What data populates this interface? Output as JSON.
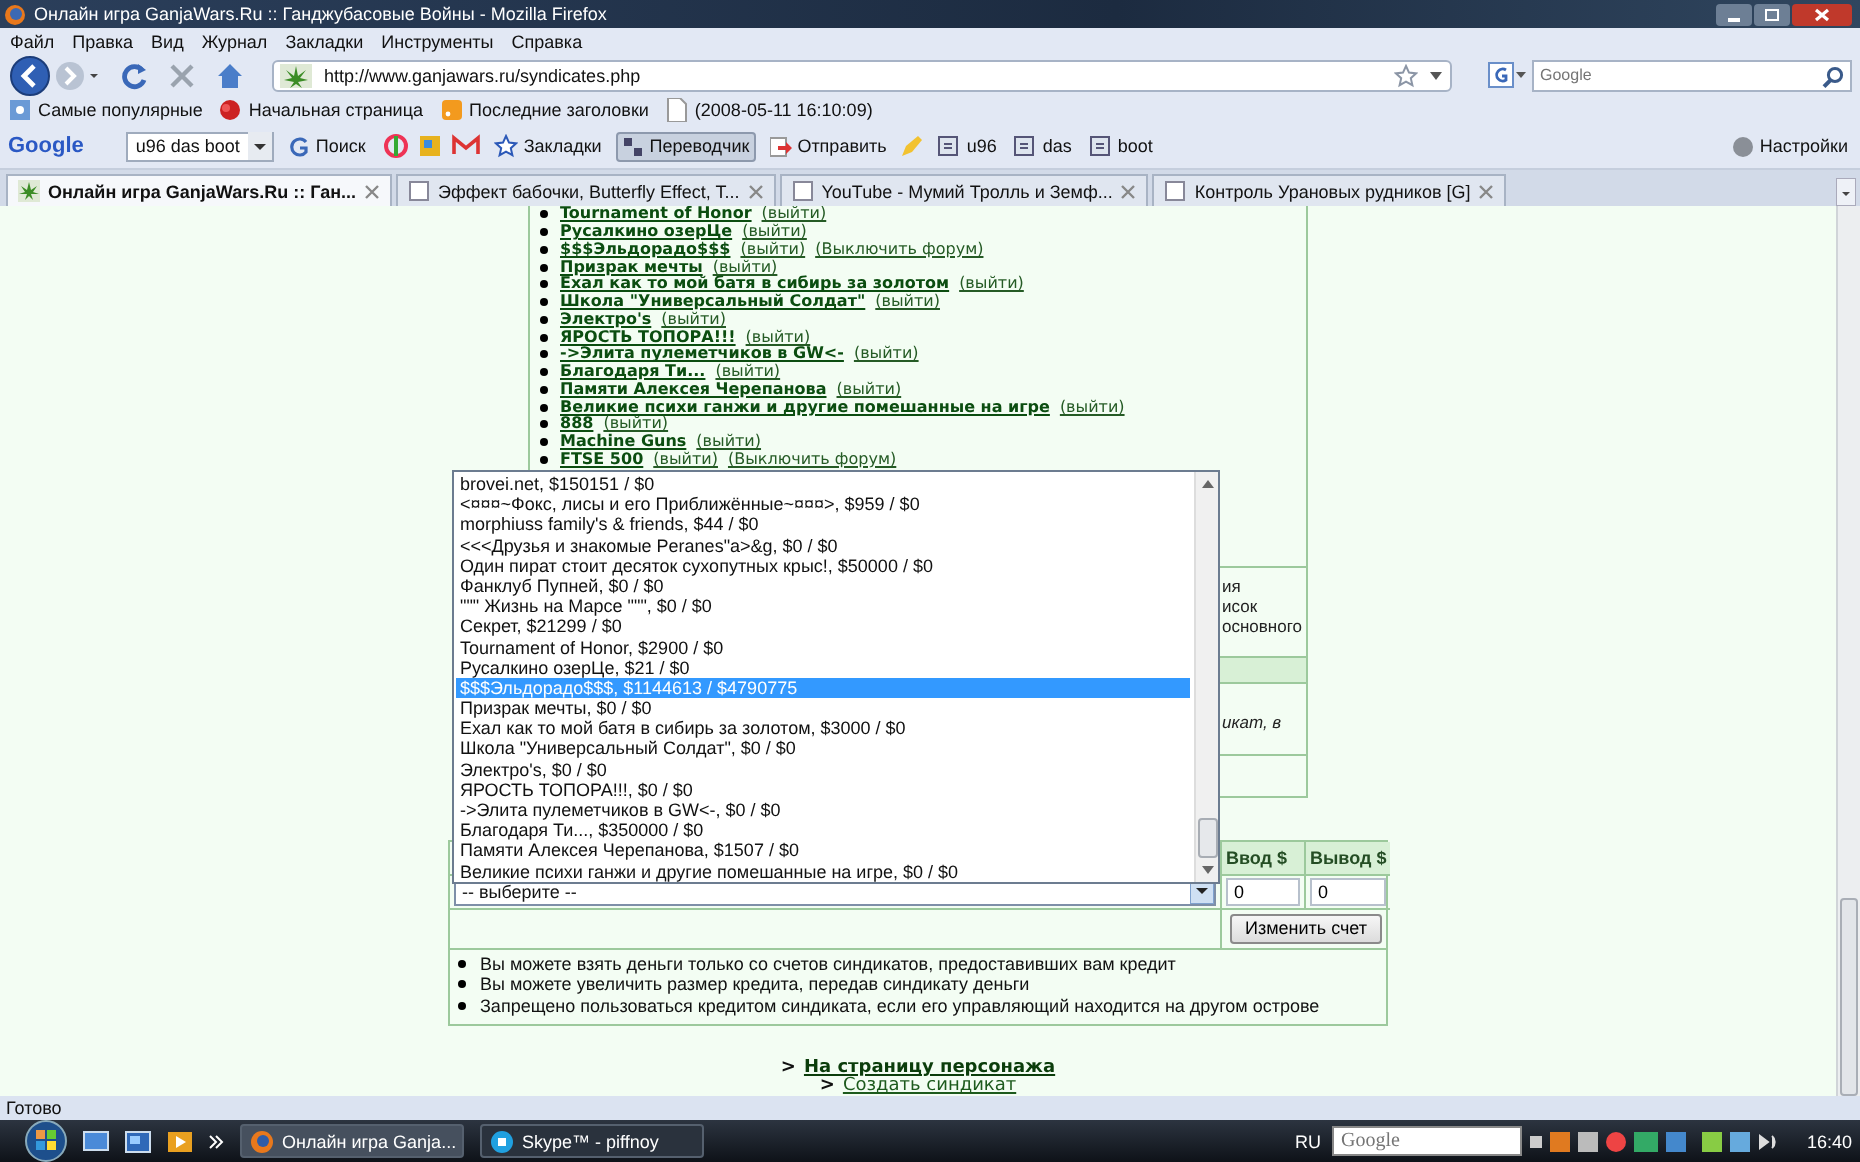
{
  "window": {
    "title": "Онлайн игра GanjaWars.Ru :: Ганджубасовые Войны - Mozilla Firefox"
  },
  "menu": [
    "Файл",
    "Правка",
    "Вид",
    "Журнал",
    "Закладки",
    "Инструменты",
    "Справка"
  ],
  "address": {
    "value": "http://www.ganjawars.ru/syndicates.php"
  },
  "search": {
    "placeholder": "Google"
  },
  "bookmarks": [
    {
      "label": "Самые популярные",
      "kind": "smart"
    },
    {
      "label": "Начальная страница",
      "kind": "page"
    },
    {
      "label": "Последние заголовки",
      "kind": "feed"
    },
    {
      "label": "(2008-05-11 16:10:09)",
      "kind": "file"
    }
  ],
  "google_toolbar": {
    "logo": "Google",
    "query": "u96 das boot",
    "search_button": "Поиск",
    "bookmarks_button": "Закладки",
    "translator_button": "Переводчик",
    "send_button": "Отправить",
    "terms": [
      "u96",
      "das",
      "boot"
    ],
    "settings": "Настройки"
  },
  "tabs": [
    {
      "label": "Онлайн игра GanjaWars.Ru :: Ган...",
      "selected": true
    },
    {
      "label": "Эффект бабочки, Butterfly Effect, T...",
      "selected": false
    },
    {
      "label": "YouTube - Мумий Тролль и Земф...",
      "selected": false
    },
    {
      "label": "Контроль Урановых рудников [G]",
      "selected": false
    }
  ],
  "syndicates": [
    {
      "name": "Tournament of Honor",
      "links": [
        "(выйти)"
      ]
    },
    {
      "name": "Русалкино озерЦе",
      "links": [
        "(выйти)"
      ]
    },
    {
      "name": "$$$Эльдорадо$$$",
      "links": [
        "(выйти)",
        "(Выключить форум)"
      ]
    },
    {
      "name": "Призрак мечты",
      "links": [
        "(выйти)"
      ]
    },
    {
      "name": "Ехал как то мой батя в сибирь за золотом",
      "links": [
        "(выйти)"
      ]
    },
    {
      "name": "Школа \"Универсальный Солдат\"",
      "links": [
        "(выйти)"
      ]
    },
    {
      "name": "Электро's",
      "links": [
        "(выйти)"
      ]
    },
    {
      "name": "ЯРОСТЬ ТОПОРА!!!",
      "links": [
        "(выйти)"
      ]
    },
    {
      "name": "->Элита пулеметчиков в GW<-",
      "links": [
        "(выйти)"
      ]
    },
    {
      "name": "Благодаря Ти...",
      "links": [
        "(выйти)"
      ]
    },
    {
      "name": "Памяти Алексея Черепанова",
      "links": [
        "(выйти)"
      ]
    },
    {
      "name": "Великие психи ганжи и другие помешанные на игре",
      "links": [
        "(выйти)"
      ]
    },
    {
      "name": "888",
      "links": [
        "(выйти)"
      ]
    },
    {
      "name": "Machine Guns",
      "links": [
        "(выйти)"
      ]
    },
    {
      "name": "FTSE 500",
      "links": [
        "(выйти)",
        "(Выключить форум)"
      ]
    }
  ],
  "hidden_panel": {
    "lines": [
      "ия",
      "исок",
      "основного"
    ],
    "note": "икат, в"
  },
  "dropdown_list": [
    {
      "label": "brovei.net, $150151 / $0",
      "selected": false
    },
    {
      "label": "<¤¤¤~Фокс, лисы и его Приближённые~¤¤¤>, $959 / $0",
      "selected": false
    },
    {
      "label": "morphiuss family's & friends, $44 / $0",
      "selected": false
    },
    {
      "label": "<<<Друзья и знакомые Peranes\"a>&g, $0 / $0",
      "selected": false
    },
    {
      "label": "Один пират стоит десяток сухопутных крыс!, $50000 / $0",
      "selected": false
    },
    {
      "label": "Фанклуб Пупней, $0 / $0",
      "selected": false
    },
    {
      "label": "\"\"\" Жизнь на Марсе \"\"\", $0 / $0",
      "selected": false
    },
    {
      "label": "Секрет, $21299 / $0",
      "selected": false
    },
    {
      "label": "Tournament of Honor, $2900 / $0",
      "selected": false
    },
    {
      "label": "Русалкино озерЦе, $21 / $0",
      "selected": false
    },
    {
      "label": "$$$Эльдорадо$$$, $1144613 / $4790775",
      "selected": true
    },
    {
      "label": "Призрак мечты, $0 / $0",
      "selected": false
    },
    {
      "label": "Ехал как то мой батя в сибирь за золотом, $3000 / $0",
      "selected": false
    },
    {
      "label": "Школа \"Универсальный Солдат\", $0 / $0",
      "selected": false
    },
    {
      "label": "Электро's, $0 / $0",
      "selected": false
    },
    {
      "label": "ЯРОСТЬ ТОПОРА!!!, $0 / $0",
      "selected": false
    },
    {
      "label": "->Элита пулеметчиков в GW<-, $0 / $0",
      "selected": false
    },
    {
      "label": "Благодаря Ти..., $350000 / $0",
      "selected": false
    },
    {
      "label": "Памяти Алексея Черепанова, $1507 / $0",
      "selected": false
    },
    {
      "label": "Великие психи ганжи и другие помешанные на игре, $0 / $0",
      "selected": false
    }
  ],
  "credit": {
    "select": "-- выберите --",
    "columns": [
      "Ввод $",
      "Вывод $"
    ],
    "inputs": [
      "0",
      "0"
    ],
    "button": "Изменить счет",
    "notes": [
      "Вы можете взять деньги только со счетов синдикатов, предоставивших вам кредит",
      "Вы можете увеличить размер кредита, передав синдикату деньги",
      "Запрещено пользоваться кредитом синдиката, если его управляющий находится на другом острове"
    ]
  },
  "links": [
    {
      "prefix": ">",
      "label": "На страницу персонажа",
      "bold": true
    },
    {
      "prefix": ">",
      "label": "Создать синдикат",
      "bold": false
    }
  ],
  "status_bar": "Готово",
  "taskbar": {
    "tasks": [
      {
        "label": "Онлайн игра Ganja...",
        "kind": "firefox",
        "selected": true
      },
      {
        "label": "Skype™ - piffnoy",
        "kind": "skype",
        "selected": false
      }
    ],
    "language": "RU",
    "search_placeholder": "Google",
    "clock": "16:40"
  }
}
